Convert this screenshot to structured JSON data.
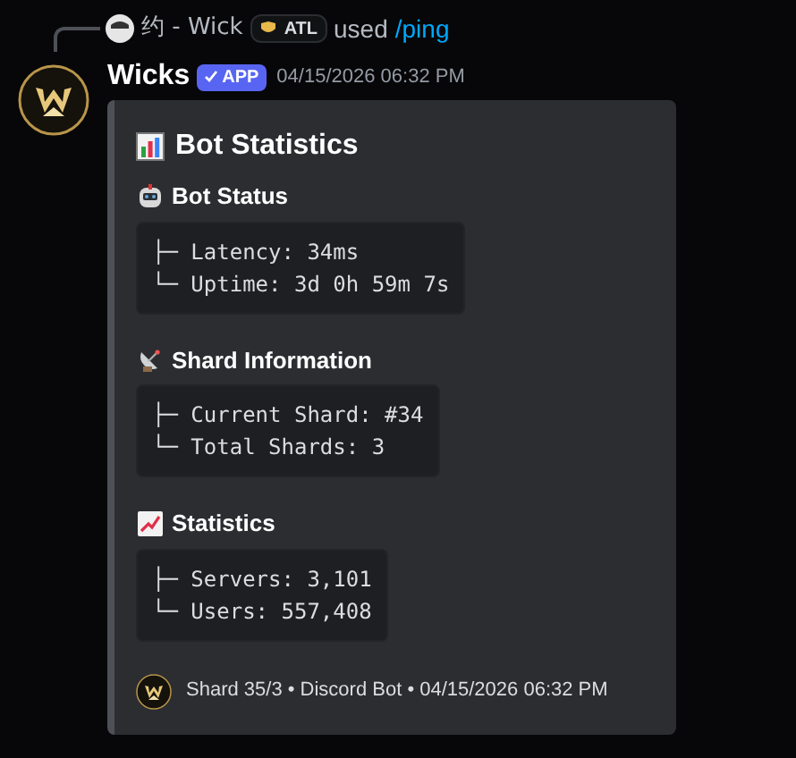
{
  "reply": {
    "author": "约 - Wick",
    "tag": "ATL",
    "action": "used",
    "command": "/ping"
  },
  "message": {
    "author": "Wicks",
    "badge": "APP",
    "timestamp": "04/15/2026 06:32 PM"
  },
  "embed": {
    "title": "Bot Statistics",
    "sections": [
      {
        "kind": "robot",
        "name": "Bot Status",
        "lines": [
          "├─ Latency: 34ms",
          "└─ Uptime: 3d 0h 59m 7s"
        ]
      },
      {
        "kind": "satellite",
        "name": "Shard Information",
        "lines": [
          "├─ Current Shard: #34",
          "└─ Total Shards: 3"
        ]
      },
      {
        "kind": "trend",
        "name": "Statistics",
        "lines": [
          "├─ Servers: 3,101",
          "└─ Users: 557,408"
        ]
      }
    ],
    "footer": {
      "text": "Shard 35/3 • Discord Bot • 04/15/2026 06:32 PM"
    }
  }
}
